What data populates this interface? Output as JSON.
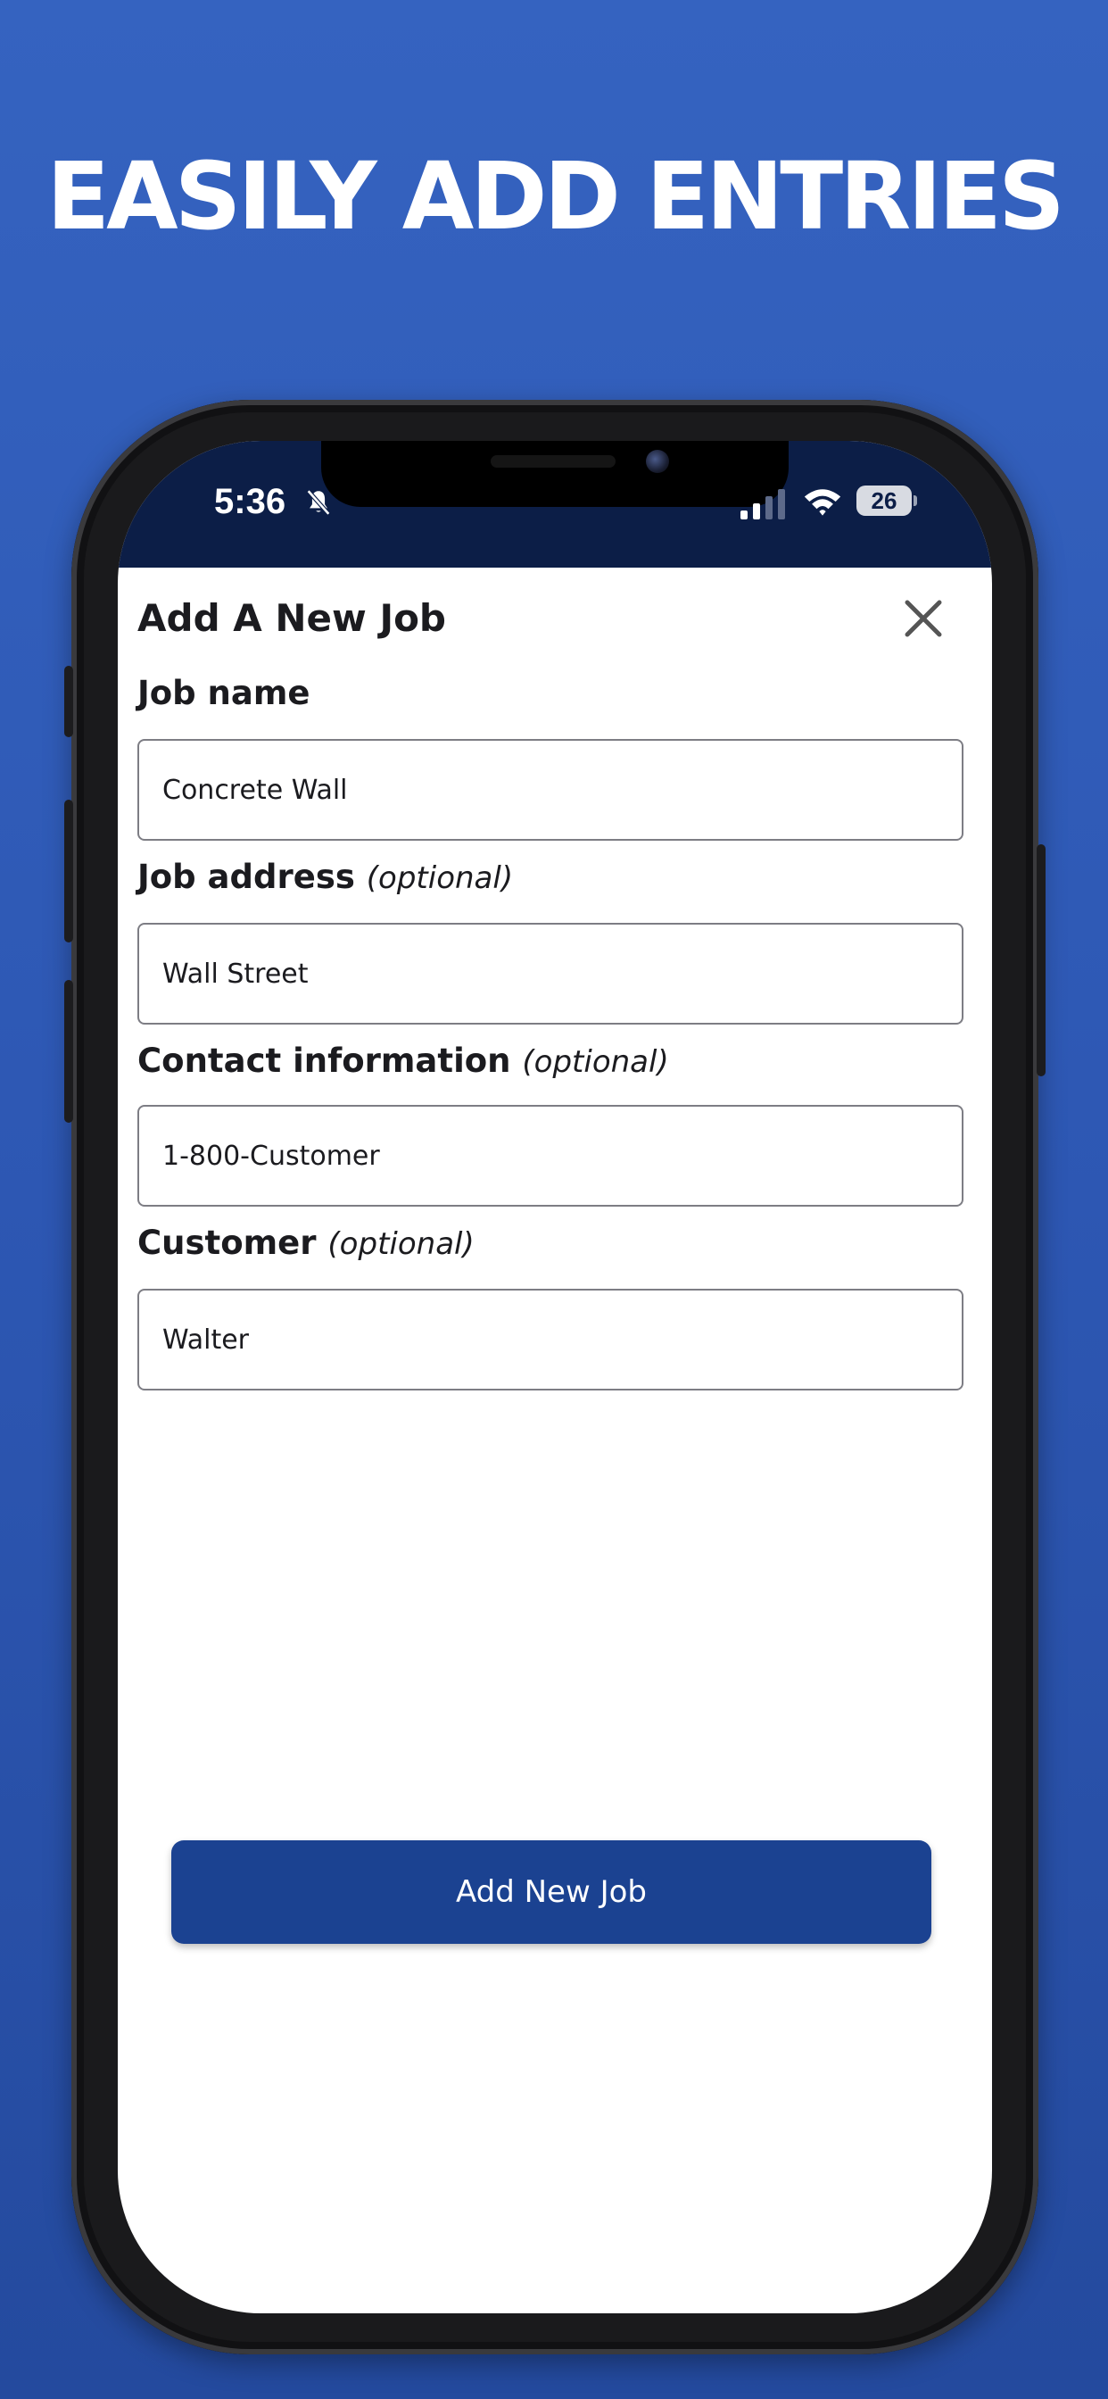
{
  "headline": "EASILY ADD ENTRIES",
  "status_bar": {
    "time": "5:36",
    "battery_level": "26",
    "icons": [
      "bell-slash-icon",
      "signal-icon",
      "wifi-icon",
      "battery-icon"
    ]
  },
  "sheet": {
    "title": "Add A New Job",
    "close_icon": "close-icon",
    "fields": [
      {
        "label": "Job name",
        "optional": "",
        "value": "Concrete Wall"
      },
      {
        "label": "Job address",
        "optional": "(optional)",
        "value": "Wall Street"
      },
      {
        "label": "Contact information",
        "optional": "(optional)",
        "value": "1-800-Customer"
      },
      {
        "label": "Customer",
        "optional": "(optional)",
        "value": "Walter"
      }
    ],
    "submit_label": "Add New Job"
  },
  "colors": {
    "background": "#3563c0",
    "status_bar": "#0c1e47",
    "button": "#1b4291",
    "text": "#1b1b1f"
  }
}
